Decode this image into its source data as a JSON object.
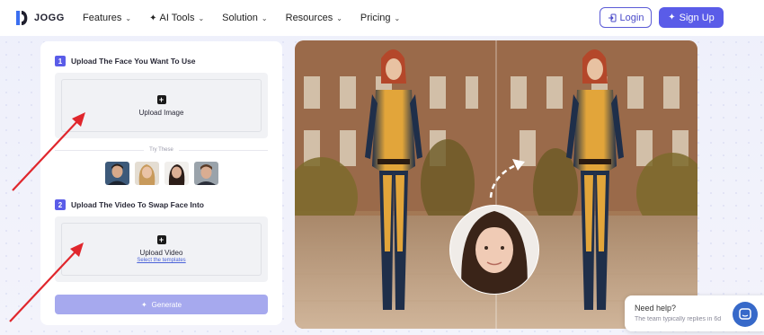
{
  "header": {
    "logo_text": "JOGG",
    "nav": [
      {
        "label": "Features"
      },
      {
        "label": "AI Tools"
      },
      {
        "label": "Solution"
      },
      {
        "label": "Resources"
      },
      {
        "label": "Pricing"
      }
    ],
    "login_label": "Login",
    "signup_label": "Sign Up"
  },
  "panel": {
    "step1": {
      "number": "1",
      "title": "Upload The Face You Want To Use"
    },
    "upload_image_label": "Upload Image",
    "try_label": "Try These",
    "step2": {
      "number": "2",
      "title": "Upload The Video To Swap Face Into"
    },
    "upload_video_label": "Upload Video",
    "templates_link": "Select the templates",
    "generate_label": "Generate"
  },
  "help": {
    "title": "Need help?",
    "subtitle": "The team typically replies in 6d"
  },
  "colors": {
    "accent": "#5a5ce8",
    "generate_disabled": "#a6a9ee",
    "arrow_red": "#e0262c",
    "chat_blue": "#3769c9"
  }
}
